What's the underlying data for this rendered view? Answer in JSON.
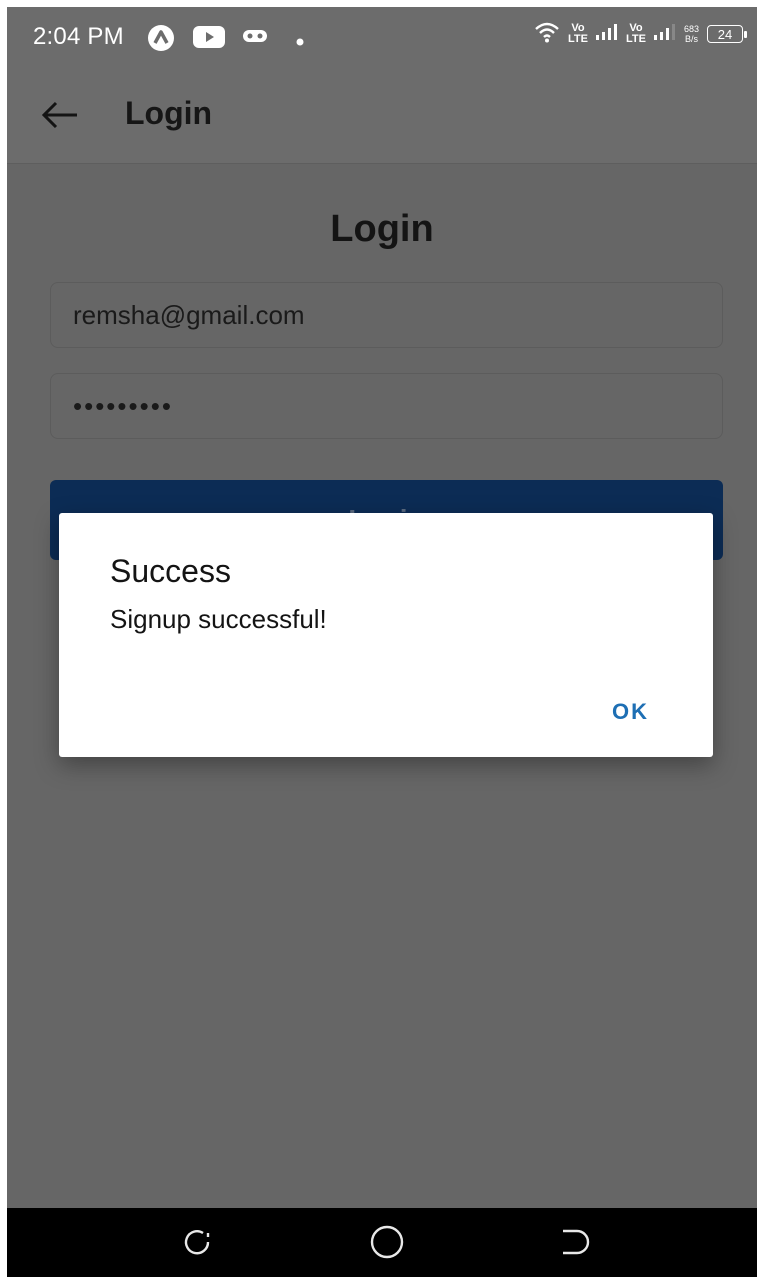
{
  "status_bar": {
    "time": "2:04 PM",
    "net1": {
      "top": "Vo",
      "bottom": "LTE"
    },
    "net2": {
      "top": "Vo",
      "bottom": "LTE"
    },
    "speed": {
      "value": "683",
      "unit": "B/s"
    },
    "battery": "24",
    "icons": [
      "app-icon",
      "youtube-icon",
      "gamepad-icon",
      "dot-icon",
      "wifi-icon",
      "signal-icon",
      "signal-icon",
      "battery-icon"
    ]
  },
  "app_bar": {
    "title": "Login",
    "back_icon": "arrow-left-icon"
  },
  "form": {
    "heading": "Login",
    "email_value": "remsha@gmail.com",
    "password_value": "•••••••••",
    "submit_label": "Login"
  },
  "dialog": {
    "title": "Success",
    "message": "Signup successful!",
    "ok_label": "OK"
  },
  "nav_bar": {
    "icons": [
      "recents-icon",
      "home-icon",
      "back-icon"
    ]
  },
  "colors": {
    "scrim": "#666666",
    "primary_button": "#0c2c55",
    "dialog_action": "#1e6fb4",
    "nav_bar": "#000000"
  }
}
